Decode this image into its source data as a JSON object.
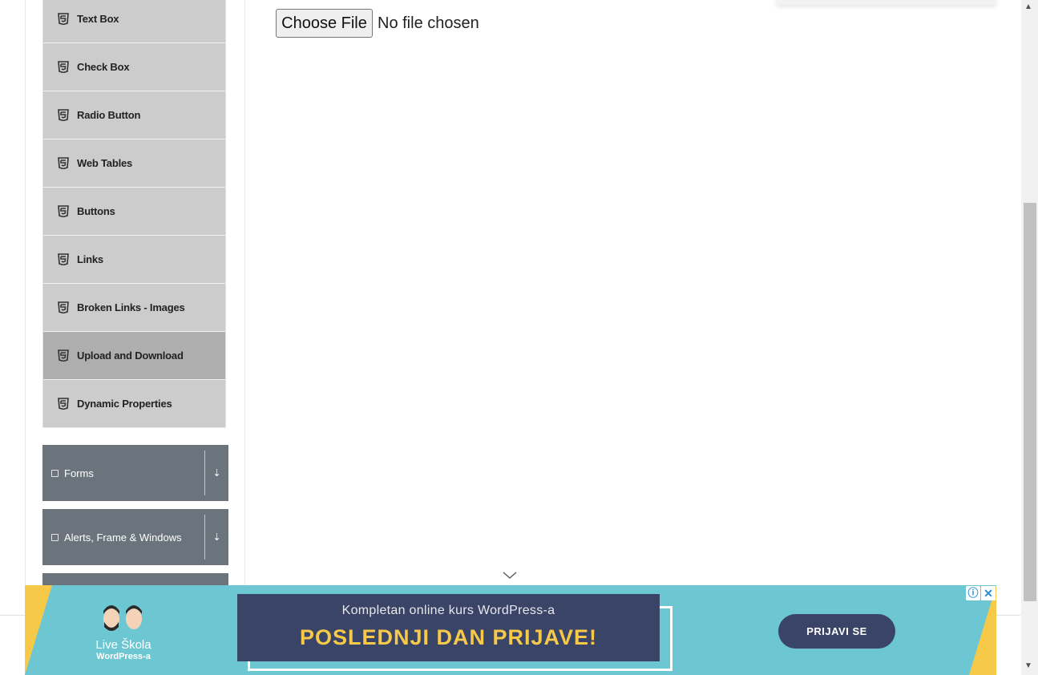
{
  "sidebar": {
    "items": [
      {
        "label": "Text Box",
        "icon": "html5-icon"
      },
      {
        "label": "Check Box",
        "icon": "html5-icon"
      },
      {
        "label": "Radio Button",
        "icon": "html5-icon"
      },
      {
        "label": "Web Tables",
        "icon": "html5-icon"
      },
      {
        "label": "Buttons",
        "icon": "html5-icon"
      },
      {
        "label": "Links",
        "icon": "html5-icon"
      },
      {
        "label": "Broken Links - Images",
        "icon": "html5-icon"
      },
      {
        "label": "Upload and Download",
        "icon": "html5-icon",
        "active": true
      },
      {
        "label": "Dynamic Properties",
        "icon": "html5-icon"
      }
    ],
    "groups": [
      {
        "label": "Forms",
        "icon": "form-icon",
        "arrow": "⇣"
      },
      {
        "label": "Alerts, Frame & Windows",
        "icon": "window-icon",
        "arrow": "⇣"
      }
    ]
  },
  "upload": {
    "button_label": "Choose File",
    "status_text": "No file chosen"
  },
  "ad": {
    "logo_line1": "Live Škola",
    "logo_line2": "WordPress-a",
    "subtitle": "Kompletan online kurs WordPress-a",
    "headline": "POSLEDNJI DAN PRIJAVE!",
    "cta": "PRIJAVI SE",
    "info_glyph": "ⓘ",
    "close_glyph": "✕",
    "colors": {
      "background": "#6cc7d3",
      "box": "#3a4466",
      "headline": "#f7c948",
      "accent": "#f7c948"
    }
  },
  "scrollbar": {
    "up_glyph": "▲",
    "down_glyph": "▼"
  }
}
